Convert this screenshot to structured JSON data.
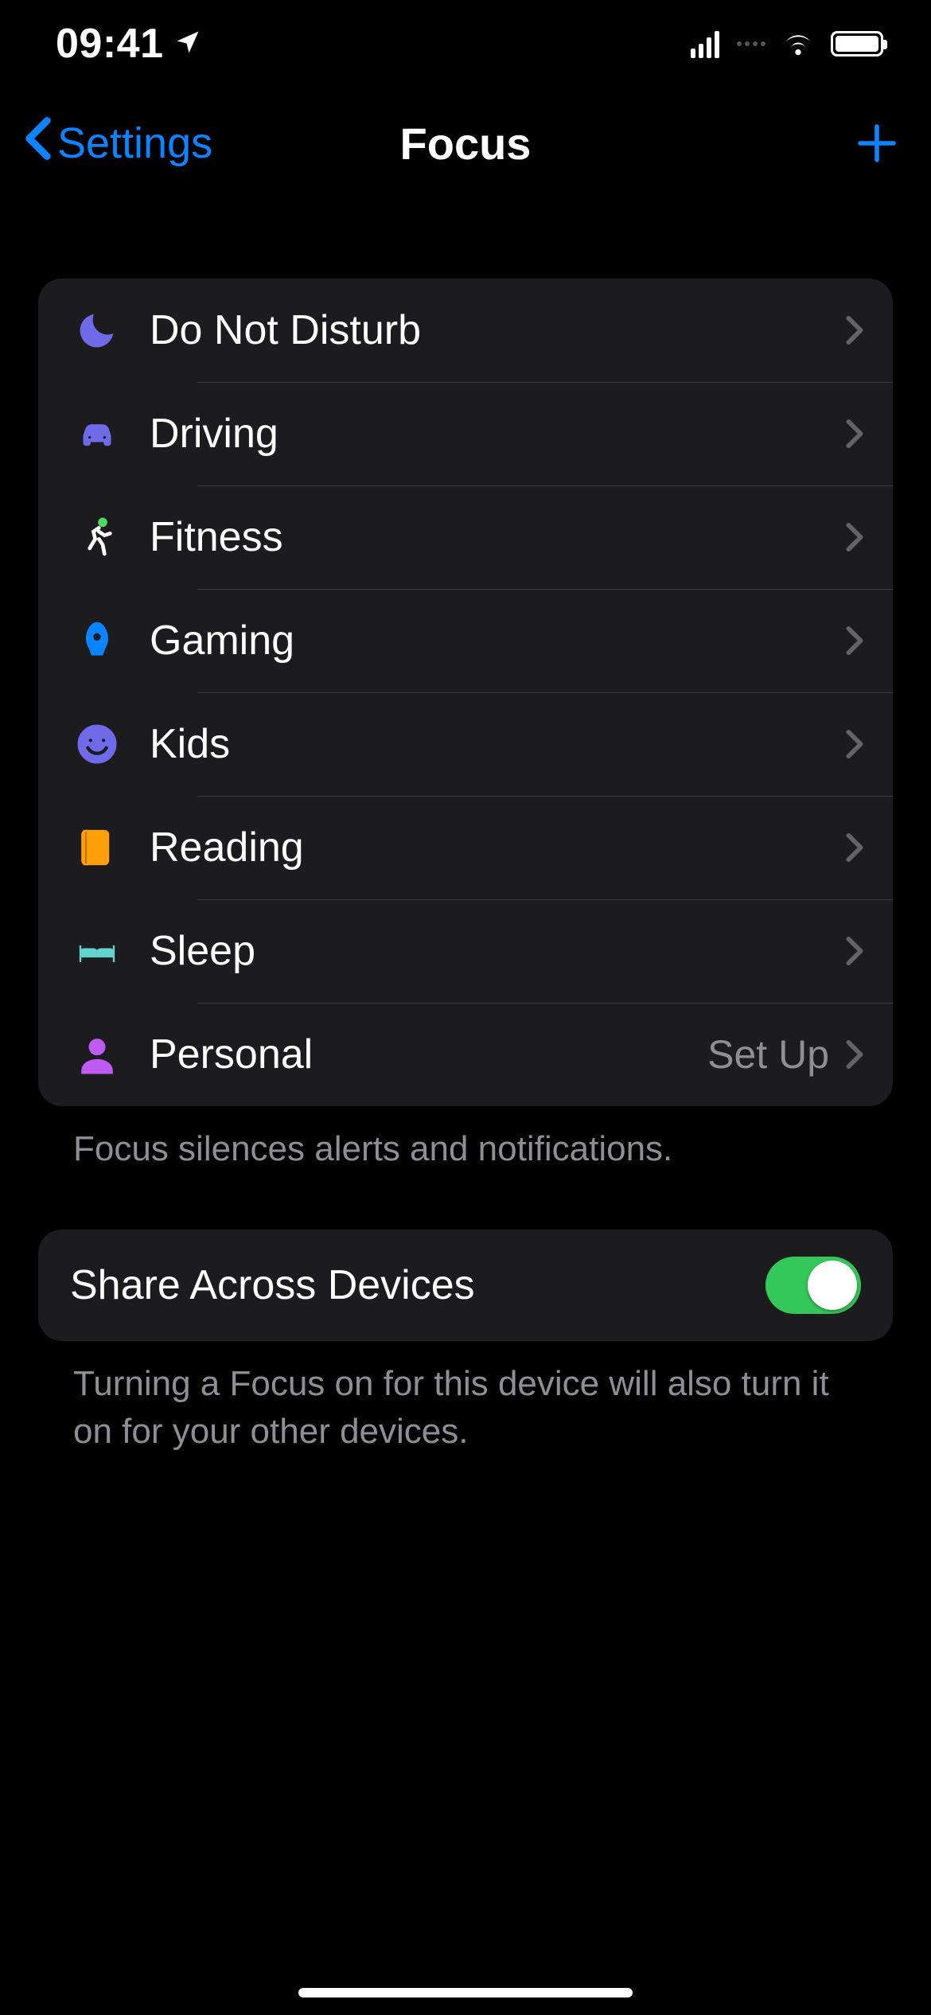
{
  "statusBar": {
    "time": "09:41"
  },
  "nav": {
    "backLabel": "Settings",
    "title": "Focus"
  },
  "focusList": {
    "items": [
      {
        "id": "dnd",
        "label": "Do Not Disturb",
        "icon": "moon-icon",
        "color": "#6e6ae8",
        "detail": ""
      },
      {
        "id": "driving",
        "label": "Driving",
        "icon": "car-icon",
        "color": "#6e6ae8",
        "detail": ""
      },
      {
        "id": "fitness",
        "label": "Fitness",
        "icon": "running-icon",
        "color": "#4cd964",
        "detail": ""
      },
      {
        "id": "gaming",
        "label": "Gaming",
        "icon": "rocket-icon",
        "color": "#0a84ff",
        "detail": ""
      },
      {
        "id": "kids",
        "label": "Kids",
        "icon": "smiley-icon",
        "color": "#6e6ae8",
        "detail": ""
      },
      {
        "id": "reading",
        "label": "Reading",
        "icon": "book-icon",
        "color": "#ff9f0a",
        "detail": ""
      },
      {
        "id": "sleep",
        "label": "Sleep",
        "icon": "bed-icon",
        "color": "#64d2ce",
        "detail": ""
      },
      {
        "id": "personal",
        "label": "Personal",
        "icon": "person-icon",
        "color": "#bf5af2",
        "detail": "Set Up"
      }
    ],
    "footer": "Focus silences alerts and notifications."
  },
  "share": {
    "label": "Share Across Devices",
    "enabled": true,
    "footer": "Turning a Focus on for this device will also turn it on for your other devices."
  }
}
